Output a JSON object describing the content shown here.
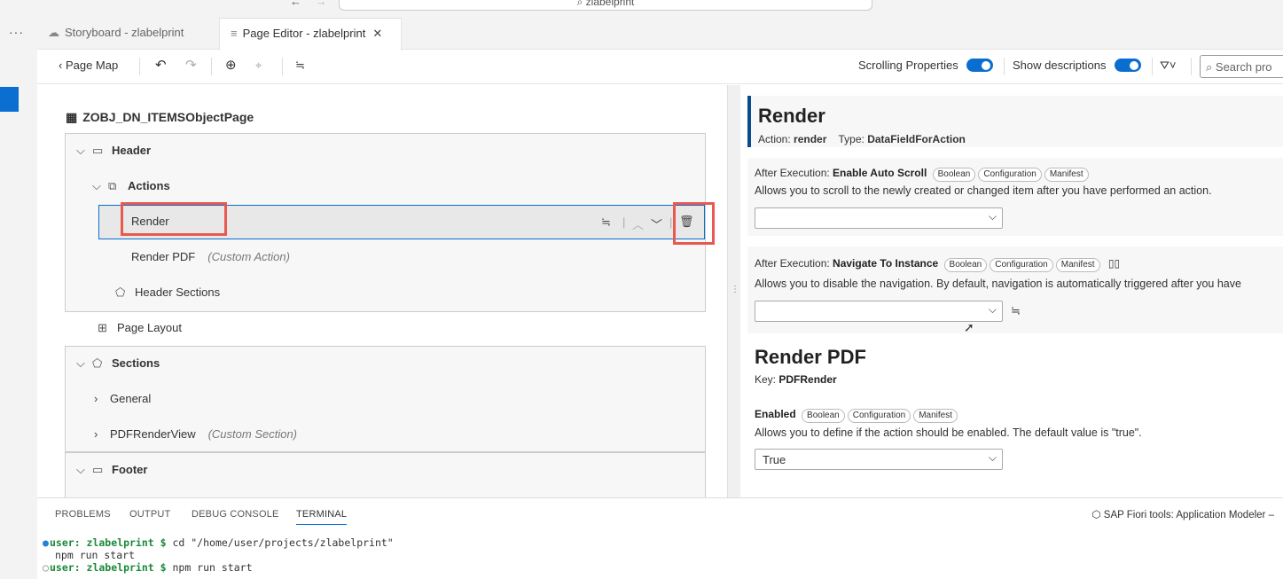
{
  "titlebar": {
    "back": "←",
    "forward": "→",
    "search_text": "⌕ zlabelprint"
  },
  "activitybar": {
    "more": "···"
  },
  "tabs": [
    {
      "icon": "☁",
      "label": "Storyboard - zlabelprint"
    },
    {
      "icon": "≡",
      "label": "Page Editor - zlabelprint",
      "close": "✕"
    }
  ],
  "toolbar": {
    "page_map": "Page Map",
    "undo": "↶",
    "redo": "↷",
    "globe": "⊕",
    "brush": "⌖",
    "outline": "≒",
    "scrolling_properties": "Scrolling Properties",
    "show_descriptions": "Show descriptions",
    "filter": "⛛˅",
    "search_placeholder": "Search pro"
  },
  "tree": {
    "page_title": "ZOBJ_DN_ITEMSObjectPage",
    "header": "Header",
    "actions": "Actions",
    "render": "Render",
    "render_pdf": "Render PDF",
    "render_pdf_note": "(Custom Action)",
    "header_sections": "Header Sections",
    "page_layout": "Page Layout",
    "sections": "Sections",
    "general": "General",
    "pdf_render_view": "PDFRenderView",
    "pdf_render_view_note": "(Custom Section)",
    "footer": "Footer"
  },
  "properties": {
    "render": {
      "title": "Render",
      "action_label": "Action:",
      "action_value": "render",
      "type_label": "Type:",
      "type_value": "DataFieldForAction"
    },
    "auto_scroll": {
      "prefix": "After Execution: ",
      "name": "Enable Auto Scroll",
      "badges": [
        "Boolean",
        "Configuration",
        "Manifest"
      ],
      "desc": "Allows you to scroll to the newly created or changed item after you have performed an action.",
      "value": ""
    },
    "navigate": {
      "prefix": "After Execution: ",
      "name": "Navigate To Instance",
      "badges": [
        "Boolean",
        "Configuration",
        "Manifest"
      ],
      "desc": "Allows you to disable the navigation. By default, navigation is automatically triggered after you have",
      "value": ""
    },
    "render_pdf": {
      "title": "Render PDF",
      "key_label": "Key:",
      "key_value": "PDFRender"
    },
    "enabled": {
      "name": "Enabled",
      "badges": [
        "Boolean",
        "Configuration",
        "Manifest"
      ],
      "desc": "Allows you to define if the action should be enabled. The default value is \"true\".",
      "value": "True"
    }
  },
  "panel": {
    "tabs": [
      "PROBLEMS",
      "OUTPUT",
      "DEBUG CONSOLE",
      "TERMINAL"
    ],
    "right_label": "SAP Fiori tools: Application Modeler",
    "terminal": [
      {
        "prompt": "user: zlabelprint $",
        "cmd": " cd \"/home/user/projects/zlabelprint\""
      },
      {
        "prompt": "",
        "cmd": "npm run start"
      },
      {
        "prompt": "user: zlabelprint $",
        "cmd": " npm run start"
      }
    ]
  },
  "colors": {
    "accent": "#0a6ed1",
    "highlight": "#e8594f",
    "prompt": "#1a8a3a"
  }
}
